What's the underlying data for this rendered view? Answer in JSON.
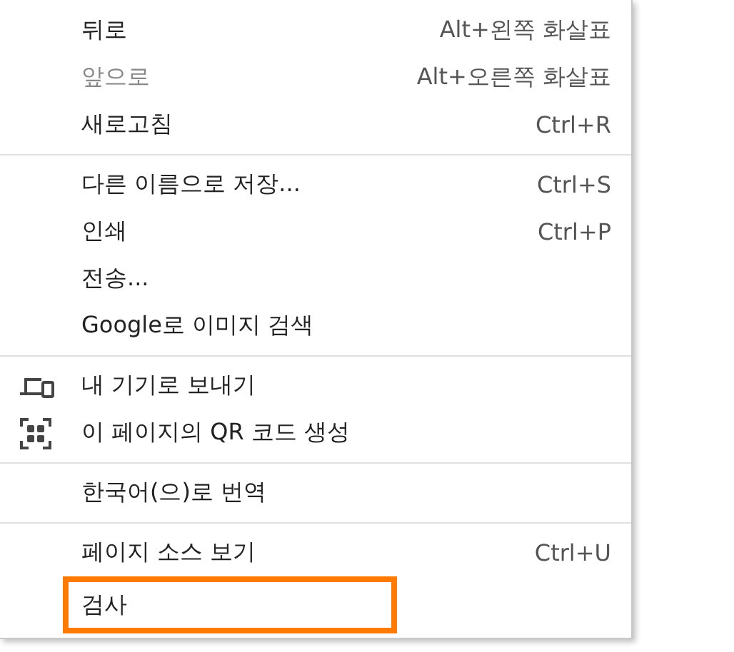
{
  "menu": {
    "groups": [
      {
        "items": [
          {
            "label": "뒤로",
            "shortcut": "Alt+왼쪽 화살표",
            "disabled": false,
            "highlighted": false
          },
          {
            "label": "앞으로",
            "shortcut": "Alt+오른쪽 화살표",
            "disabled": true,
            "highlighted": false
          },
          {
            "label": "새로고침",
            "shortcut": "Ctrl+R",
            "disabled": false,
            "highlighted": false
          }
        ]
      },
      {
        "items": [
          {
            "label": "다른 이름으로 저장...",
            "shortcut": "Ctrl+S",
            "disabled": false,
            "highlighted": false
          },
          {
            "label": "인쇄",
            "shortcut": "Ctrl+P",
            "disabled": false,
            "highlighted": false
          },
          {
            "label": "전송...",
            "disabled": false,
            "highlighted": false
          },
          {
            "label": "Google로 이미지 검색",
            "disabled": false,
            "highlighted": false
          }
        ]
      },
      {
        "items": [
          {
            "label": "내 기기로 보내기",
            "kind": "devices",
            "disabled": false,
            "highlighted": false
          },
          {
            "label": "이 페이지의 QR 코드 생성",
            "kind": "qr",
            "disabled": false,
            "highlighted": false
          }
        ]
      },
      {
        "items": [
          {
            "label": "한국어(으)로 번역",
            "disabled": false,
            "highlighted": false
          }
        ]
      },
      {
        "items": [
          {
            "label": "페이지 소스 보기",
            "shortcut": "Ctrl+U",
            "disabled": false,
            "highlighted": false
          },
          {
            "label": "검사",
            "disabled": false,
            "highlighted": true
          }
        ]
      }
    ]
  }
}
